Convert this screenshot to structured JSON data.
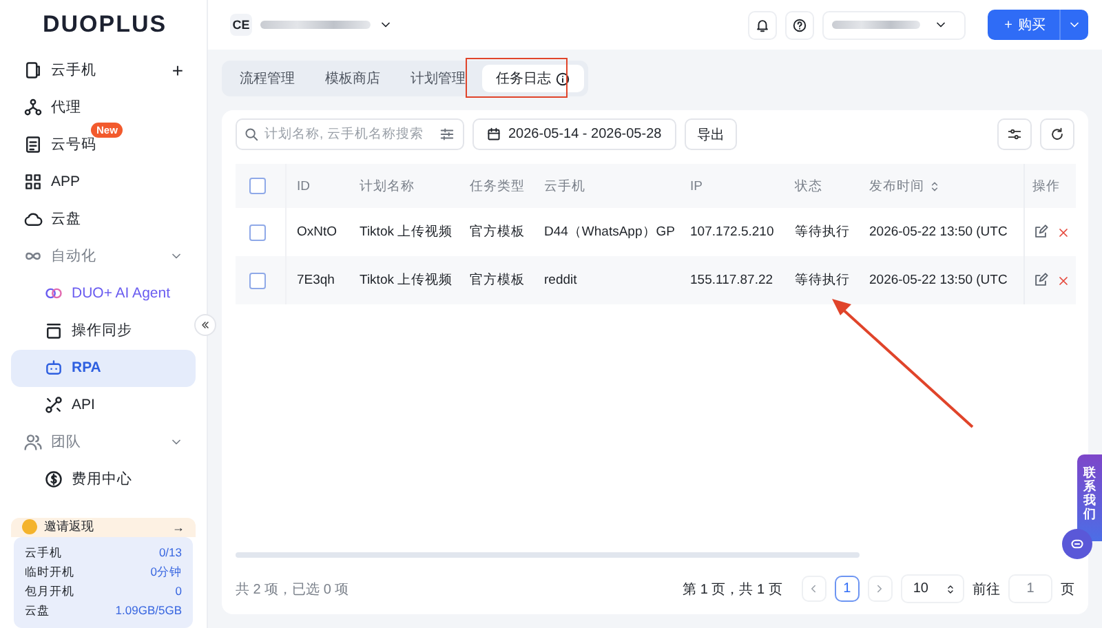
{
  "logo": "DUOPLUS",
  "nav": [
    {
      "kind": "item",
      "label": "云手机",
      "selected": false,
      "add": "+"
    },
    {
      "kind": "item",
      "label": "代理",
      "selected": false
    },
    {
      "kind": "item",
      "label": "云号码",
      "selected": false,
      "badge": "New"
    },
    {
      "kind": "item",
      "label": "APP",
      "selected": false
    },
    {
      "kind": "item",
      "label": "云盘",
      "selected": false
    },
    {
      "kind": "group",
      "label": "自动化",
      "expanded": true,
      "children": [
        {
          "kind": "ai",
          "label": "DUO+ AI Agent",
          "selected": false
        },
        {
          "kind": "sub",
          "label": "操作同步",
          "selected": false
        },
        {
          "kind": "sub",
          "label": "RPA",
          "selected": true
        },
        {
          "kind": "sub",
          "label": "API",
          "selected": false
        }
      ]
    },
    {
      "kind": "group",
      "label": "团队",
      "expanded": true,
      "children": [
        {
          "kind": "sub",
          "label": "费用中心",
          "selected": false
        }
      ]
    }
  ],
  "invite": {
    "label": "邀请返现",
    "arrow": "→"
  },
  "stats": [
    {
      "label": "云手机",
      "value": "0/13"
    },
    {
      "label": "临时开机",
      "value": "0分钟"
    },
    {
      "label": "包月开机",
      "value": "0"
    },
    {
      "label": "云盘",
      "value": "1.09GB/5GB"
    }
  ],
  "header": {
    "org_initials": "CE",
    "buy_label": "购买",
    "buy_icon": "+"
  },
  "tabs": [
    {
      "label": "流程管理",
      "selected": false
    },
    {
      "label": "模板商店",
      "selected": false
    },
    {
      "label": "计划管理",
      "selected": false
    },
    {
      "label": "任务日志",
      "selected": true
    }
  ],
  "toolbar": {
    "search_placeholder": "计划名称, 云手机名称搜索",
    "date_range": "2026-05-14 - 2026-05-28",
    "export_label": "导出"
  },
  "table": {
    "select_all_checked": false,
    "columns": [
      "ID",
      "计划名称",
      "任务类型",
      "云手机",
      "IP",
      "状态",
      "发布时间",
      "操作"
    ],
    "rows": [
      {
        "checked": false,
        "cells": [
          "OxNtO",
          "Tiktok 上传视频",
          "官方模板",
          "D44（WhatsApp）GP",
          "107.172.5.210",
          "等待执行",
          "2026-05-22 13:50 (UTC"
        ]
      },
      {
        "checked": false,
        "cells": [
          "7E3qh",
          "Tiktok 上传视频",
          "官方模板",
          "reddit",
          "155.117.87.22",
          "等待执行",
          "2026-05-22 13:50 (UTC"
        ]
      }
    ]
  },
  "footer": {
    "summary": "共 2 项，已选 0 项",
    "page_info": "第 1 页，共 1 页",
    "pages": [
      {
        "label": "1",
        "selected": true
      }
    ],
    "page_size": "10",
    "goto_label": "前往",
    "goto_value": "1",
    "page_unit": "页"
  },
  "contact": "联系我们"
}
